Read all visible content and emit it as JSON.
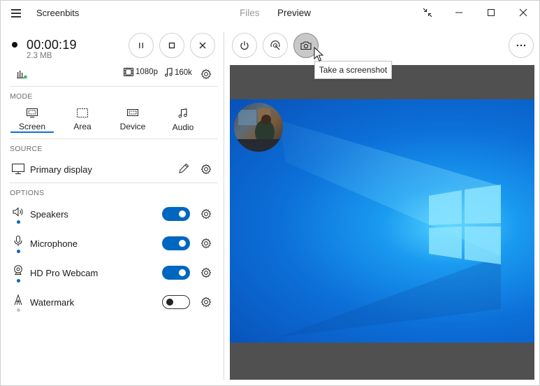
{
  "app": {
    "title": "Screenbits"
  },
  "nav": {
    "files": "Files",
    "preview": "Preview"
  },
  "recording": {
    "elapsed": "00:00:19",
    "size": "2.3 MB"
  },
  "stats": {
    "resolution": "1080p",
    "bitrate": "160k"
  },
  "mode": {
    "label": "MODE",
    "tabs": [
      {
        "label": "Screen",
        "icon": "screen-icon",
        "selected": true
      },
      {
        "label": "Area",
        "icon": "area-icon",
        "selected": false
      },
      {
        "label": "Device",
        "icon": "device-icon",
        "selected": false
      },
      {
        "label": "Audio",
        "icon": "audio-icon",
        "selected": false
      }
    ]
  },
  "source": {
    "label": "SOURCE",
    "value": "Primary display"
  },
  "options": {
    "label": "OPTIONS",
    "items": [
      {
        "label": "Speakers",
        "enabled": true
      },
      {
        "label": "Microphone",
        "enabled": true
      },
      {
        "label": "HD Pro Webcam",
        "enabled": true
      },
      {
        "label": "Watermark",
        "enabled": false
      }
    ]
  },
  "toolbar": {
    "tooltip": "Take a screenshot"
  },
  "colors": {
    "accent": "#0067c0",
    "active_underline": "#0b73d9",
    "status_green": "#22c55e"
  }
}
